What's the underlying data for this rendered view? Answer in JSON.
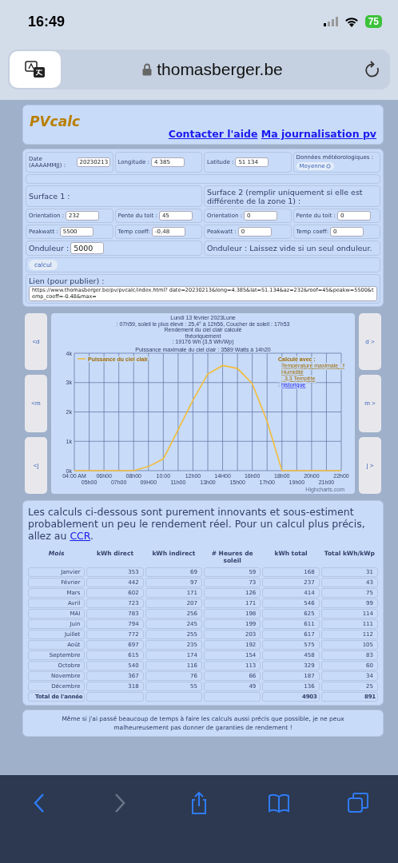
{
  "status_bar": {
    "time": "16:49",
    "battery": "75"
  },
  "browser": {
    "url": "thomasberger.be"
  },
  "header": {
    "logo": "PVcalc",
    "links": [
      "Contacter l'aide",
      "Ma journalisation pv"
    ]
  },
  "form": {
    "top_fields": [
      {
        "label": "Date (AAAAMMJJ) :",
        "value": "20230213"
      },
      {
        "label": "Longitude :",
        "value": "4 385"
      },
      {
        "label": "Latitude :",
        "value": "51 134"
      }
    ],
    "weather": {
      "label": "Données météorologiques :",
      "value": "Moyenne"
    },
    "surfaces": [
      {
        "title": "Surface 1 :",
        "fields": [
          {
            "label": "Orientation :",
            "value": "232"
          },
          {
            "label": "Pente du toit :",
            "value": "45"
          },
          {
            "label": "Peakwatt :",
            "value": "5500"
          },
          {
            "label": "Temp coeff:",
            "value": "-0,48"
          }
        ],
        "inverter": {
          "label": "Onduleur :",
          "value": "5000"
        }
      },
      {
        "title": "Surface 2 (remplir uniquement si elle est différente de la zone 1) :",
        "fields": [
          {
            "label": "Orientation :",
            "value": "0"
          },
          {
            "label": "Pente du toit :",
            "value": "0"
          },
          {
            "label": "Peakwatt :",
            "value": "0"
          },
          {
            "label": "Temp coeff:",
            "value": "0"
          }
        ],
        "inverter": {
          "label": "Onduleur : Laissez vide si un seul onduleur."
        }
      }
    ],
    "calc_button": "calcul",
    "share": {
      "label": "Lien (pour publier) :",
      "value": "https://www.thomasberger.be/pv/pvcalc/index.html? date=20230213&long=4.385&lat=51.134&az=232&roof=45&peakw=5500&temp_coeff=-0.48&max="
    }
  },
  "chart_panel": {
    "nav_left": [
      "<d",
      "<m",
      "<j"
    ],
    "nav_right": [
      "d >",
      "m >",
      "j >"
    ],
    "title_lines": [
      "Lundi 13 février 2023Lune",
      ": 07h59, soleil le plus élevé : 25,4° à 12h56, Coucher de soleil : 17h53",
      "Rendement du ciel clair calculé",
      "théoriquement",
      ": 19176 Wh (3,5 Wh/Wp)"
    ],
    "max_note": "Puissance maximale du ciel clair : 3589 Watts à 14h20",
    "info_title": "Calculé avec :",
    "info_lines": [
      "Température maximale : f",
      "Humidité",
      ": 3,3 Tempête"
    ],
    "info_link_prefix": ":",
    "info_link": "historique",
    "credit": "Highcharts.com",
    "chart_data": {
      "type": "line",
      "categories": [
        "04:00 AM",
        "05h00",
        "06h00",
        "07h00",
        "08h00",
        "09H00",
        "10:00",
        "11h00",
        "12h00",
        "13h00",
        "14H00",
        "15h00",
        "16h00",
        "17h00",
        "18h00",
        "19h00",
        "20h00",
        "21h00",
        "22h00"
      ],
      "series": [
        {
          "name": "Puissance du ciel clair",
          "color": "#f2bd3a",
          "values": [
            0,
            0,
            0,
            0,
            0,
            140,
            400,
            1390,
            2400,
            3290,
            3580,
            3480,
            2960,
            1680,
            0,
            0,
            0,
            0,
            0
          ]
        }
      ],
      "grid": true,
      "ylim": [
        0,
        4000
      ],
      "yticks": [
        {
          "value": 0,
          "label": "0k"
        },
        {
          "value": 1000,
          "label": "1k"
        },
        {
          "value": 2000,
          "label": "2k"
        },
        {
          "value": 3000,
          "label": "3k"
        },
        {
          "value": 4000,
          "label": "4k"
        }
      ]
    }
  },
  "intro": {
    "text": "Les calculs ci-dessous sont purement innovants et sous-estiment probablement un peu le rendement réel. Pour un calcul plus précis, allez au ",
    "link": "CCR",
    "after": "."
  },
  "table": {
    "columns": [
      "Mois",
      "kWh direct",
      "kWh indirect",
      "# Heures de soleil",
      "kWh total",
      "Total kWh/kWp"
    ],
    "rows": [
      [
        "Janvier",
        "353",
        "69",
        "59",
        "168",
        "31"
      ],
      [
        "Février",
        "442",
        "97",
        "73",
        "237",
        "43"
      ],
      [
        "Mars",
        "602",
        "171",
        "126",
        "414",
        "75"
      ],
      [
        "Avril",
        "723",
        "207",
        "171",
        "546",
        "99"
      ],
      [
        "MAI",
        "783",
        "256",
        "198",
        "625",
        "114"
      ],
      [
        "Juin",
        "794",
        "245",
        "199",
        "611",
        "111"
      ],
      [
        "Juillet",
        "772",
        "255",
        "203",
        "617",
        "112"
      ],
      [
        "Août",
        "697",
        "235",
        "192",
        "575",
        "105"
      ],
      [
        "Septembre",
        "615",
        "174",
        "154",
        "458",
        "83"
      ],
      [
        "Octobre",
        "540",
        "116",
        "113",
        "329",
        "60"
      ],
      [
        "Novembre",
        "367",
        "76",
        "66",
        "187",
        "34"
      ],
      [
        "Décembre",
        "318",
        "55",
        "49",
        "136",
        "25"
      ]
    ],
    "total": {
      "label": "Total de l'année",
      "kwh_total": "4903",
      "kwh_per_kwp": "891"
    }
  },
  "disclaimer": "Même si j'ai passé beaucoup de temps à faire les calculs aussi précis que possible, je ne peux malheureusement pas donner de garanties de rendement !",
  "toolbar": [
    {
      "kind": "back",
      "disabled": false
    },
    {
      "kind": "forward",
      "disabled": true
    },
    {
      "kind": "share",
      "disabled": false
    },
    {
      "kind": "bookmarks",
      "disabled": false
    },
    {
      "kind": "tabs",
      "disabled": false
    }
  ]
}
